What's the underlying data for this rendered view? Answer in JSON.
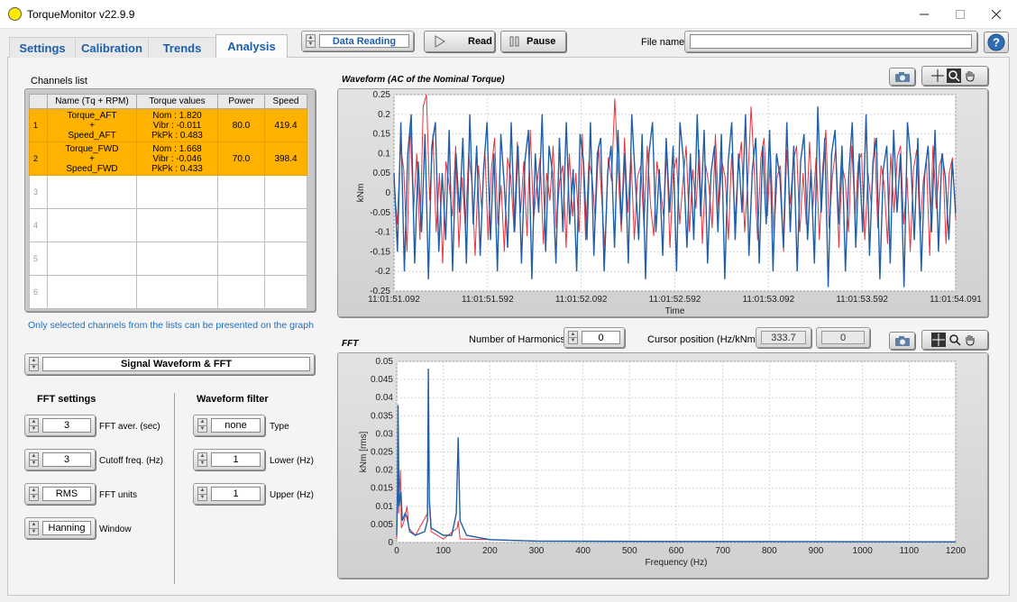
{
  "window": {
    "title": "TorqueMonitor v22.9.9"
  },
  "tabs": [
    {
      "label": "Settings"
    },
    {
      "label": "Calibration"
    },
    {
      "label": "Trends"
    },
    {
      "label": "Analysis"
    }
  ],
  "toolbar": {
    "mode_value": "Data Reading",
    "read_label": "Read",
    "pause_label": "Pause",
    "file_name_label": "File name",
    "file_name_value": ""
  },
  "channels": {
    "title": "Channels list",
    "headers": [
      "Name (Tq + RPM)",
      "Torque values",
      "Power",
      "Speed"
    ],
    "rows": [
      {
        "index": "1",
        "name": [
          "Torque_AFT",
          "+",
          "Speed_AFT"
        ],
        "torque": [
          "Nom : 1.820",
          "Vibr : -0.011",
          "PkPk : 0.483"
        ],
        "power": "80.0",
        "speed": "419.4"
      },
      {
        "index": "2",
        "name": [
          "Torque_FWD",
          "+",
          "Speed_FWD"
        ],
        "torque": [
          "Nom : 1.668",
          "Vibr : -0.046",
          "PkPk : 0.433"
        ],
        "power": "70.0",
        "speed": "398.4"
      },
      {
        "index": "3"
      },
      {
        "index": "4"
      },
      {
        "index": "5"
      },
      {
        "index": "6"
      }
    ],
    "note": "Only selected channels from the lists can be presented on the graph"
  },
  "view_mode": "Signal Waveform & FFT",
  "fft_settings": {
    "title": "FFT settings",
    "aver_value": "3",
    "aver_label": "FFT aver. (sec)",
    "cutoff_value": "3",
    "cutoff_label": "Cutoff freq. (Hz)",
    "units_value": "RMS",
    "units_label": "FFT units",
    "window_value": "Hanning",
    "window_label": "Window"
  },
  "waveform_filter": {
    "title": "Waveform filter",
    "type_value": "none",
    "type_label": "Type",
    "lower_value": "1",
    "lower_label": "Lower (Hz)",
    "upper_value": "1",
    "upper_label": "Upper (Hz)"
  },
  "harmonics": {
    "label": "Number of Harmonics",
    "value": "0"
  },
  "cursor": {
    "label": "Cursor position (Hz/kNm):",
    "x": "333.7",
    "y": "0"
  },
  "colors": {
    "series_blue": "#1f5fa6",
    "series_red": "#e8323c",
    "selected_row": "#ffb300",
    "tab_text": "#1a5fab"
  },
  "icons": [
    "camera-icon",
    "crosshair-icon",
    "zoom-icon",
    "hand-pan-icon",
    "help-icon",
    "play-icon",
    "pause-icon"
  ],
  "chart_data": [
    {
      "type": "line",
      "title": "Waveform (AC of the Nominal Torque)",
      "xlabel": "Time",
      "ylabel": "kNm",
      "x_tick_labels": [
        "11:01:51.092",
        "11:01:51.592",
        "11:01:52.092",
        "11:01:52.592",
        "11:01:53.092",
        "11:01:53.592",
        "11:01:54.091"
      ],
      "y_tick_labels": [
        "0.25",
        "0.2",
        "0.15",
        "0.1",
        "0.05",
        "0",
        "-0.05",
        "-0.1",
        "-0.15",
        "-0.2",
        "-0.25"
      ],
      "ylim": [
        -0.25,
        0.25
      ],
      "grid": true,
      "series": [
        {
          "color": "#e8323c",
          "y": [
            0.03,
            -0.08,
            0.12,
            0.06,
            -0.15,
            0.18,
            -0.05,
            0.1,
            -0.12,
            0.22,
            0.25,
            -0.02,
            0.15,
            -0.1,
            0.05,
            -0.18,
            0.08,
            0.02,
            -0.06,
            0.12,
            -0.14,
            0.04,
            -0.09,
            0.1,
            0.03,
            -0.16,
            0.07,
            -0.04,
            0.11,
            -0.12,
            0.06,
            0.14,
            -0.08,
            0.02,
            -0.15,
            0.09,
            0.04,
            -0.1,
            0.13,
            -0.05,
            0.08,
            -0.11,
            0.16,
            -0.07,
            0.02,
            0.09,
            -0.13,
            0.05,
            -0.02,
            0.12,
            -0.09,
            0.03,
            0.07,
            -0.14,
            0.1,
            -0.06,
            0.05,
            -0.1,
            0.15,
            -0.12,
            0.08,
            0.04,
            -0.07,
            0.12,
            -0.02,
            -0.15,
            0.09,
            0.03,
            0.24,
            0.06,
            -0.1,
            0.14,
            -0.05,
            0.1,
            -0.12,
            0.04,
            0.07,
            -0.09,
            0.12,
            -0.03,
            -0.11,
            0.08,
            0.02,
            -0.06,
            0.1,
            -0.14,
            0.05,
            0.09,
            -0.08,
            0.03,
            0.12,
            -0.1,
            0.06,
            -0.04,
            0.11,
            -0.13,
            0.07,
            0.02,
            -0.09,
            0.15,
            -0.05,
            0.08,
            0.04,
            -0.12,
            0.1,
            -0.07,
            0.06,
            0.13,
            -0.1,
            0.03,
            0.22,
            0.05,
            -0.12,
            0.09,
            0.14,
            -0.06,
            0.1,
            -0.11,
            0.04,
            0.07,
            -0.15,
            0.11,
            -0.03,
            0.08,
            0.12,
            -0.1,
            0.05,
            -0.08,
            0.13,
            -0.04,
            0.09,
            -0.12,
            0.06,
            0.16,
            -0.09,
            0.04,
            0.11,
            -0.14,
            0.07,
            0.03,
            -0.1,
            0.12,
            -0.06,
            0.08,
            0.1,
            -0.12,
            0.05,
            -0.03,
            0.14,
            -0.09,
            0.07,
            0.02,
            -0.13,
            0.1,
            -0.05,
            0.09,
            0.12,
            -0.08,
            0.04,
            -0.15,
            0.06,
            0.11,
            -0.1,
            0.03,
            0.08,
            -0.16,
            0.12,
            -0.04,
            0.07,
            0.1,
            -0.13,
            0.05,
            0.09,
            -0.07
          ]
        },
        {
          "color": "#1f5fa6",
          "y": [
            0.05,
            -0.15,
            0.18,
            -0.2,
            0.1,
            0.2,
            -0.18,
            0.08,
            -0.1,
            0.15,
            -0.22,
            0.12,
            0.18,
            -0.15,
            0.05,
            -0.12,
            0.16,
            -0.2,
            0.1,
            -0.05,
            0.14,
            -0.18,
            0.2,
            -0.08,
            0.12,
            -0.16,
            0.06,
            0.18,
            -0.12,
            0.1,
            -0.2,
            0.15,
            0.02,
            -0.14,
            0.18,
            -0.1,
            0.12,
            -0.18,
            0.08,
            0.16,
            -0.22,
            0.1,
            -0.05,
            0.2,
            -0.15,
            0.12,
            0.05,
            -0.18,
            0.14,
            -0.1,
            0.18,
            -0.08,
            0.06,
            -0.2,
            0.15,
            0.08,
            -0.12,
            0.18,
            -0.16,
            0.1,
            0.14,
            -0.2,
            0.05,
            0.12,
            -0.14,
            0.16,
            -0.08,
            0.1,
            -0.18,
            0.2,
            0.04,
            -0.12,
            0.15,
            -0.22,
            0.1,
            0.18,
            -0.1,
            0.06,
            -0.16,
            0.14,
            -0.05,
            0.12,
            -0.2,
            0.18,
            0.08,
            -0.14,
            0.1,
            -0.12,
            0.2,
            -0.06,
            0.16,
            -0.18,
            0.05,
            0.12,
            -0.1,
            0.15,
            -0.22,
            0.08,
            0.18,
            -0.12,
            0.1,
            -0.05,
            0.2,
            -0.16,
            0.06,
            0.14,
            -0.18,
            0.12,
            -0.08,
            0.16,
            -0.2,
            0.1,
            0.04,
            -0.14,
            0.18,
            -0.1,
            0.12,
            -0.2,
            0.08,
            0.15,
            -0.12,
            0.06,
            -0.18,
            0.22,
            -0.05,
            0.14,
            -0.24,
            0.1,
            0.16,
            -0.08,
            0.12,
            -0.2,
            0.05,
            0.18,
            -0.14,
            0.1,
            -0.1,
            0.2,
            -0.16,
            0.08,
            0.14,
            -0.22,
            0.06,
            0.12,
            -0.18,
            0.16,
            -0.05,
            0.1,
            -0.24,
            0.18,
            0.08,
            -0.12,
            0.14,
            -0.2,
            0.05,
            0.12,
            -0.1,
            0.16,
            -0.15,
            0.1,
            0.04,
            -0.12,
            0.08,
            -0.05
          ]
        }
      ]
    },
    {
      "type": "line",
      "title": "FFT",
      "xlabel": "Frequency (Hz)",
      "ylabel": "kNm [rms]",
      "x_tick_labels": [
        "0",
        "100",
        "200",
        "300",
        "400",
        "500",
        "600",
        "700",
        "800",
        "900",
        "1000",
        "1100",
        "1200"
      ],
      "y_tick_labels": [
        "0.05",
        "0.045",
        "0.04",
        "0.035",
        "0.03",
        "0.025",
        "0.02",
        "0.015",
        "0.01",
        "0.005",
        "0"
      ],
      "xlim": [
        0,
        1200
      ],
      "ylim": [
        0,
        0.05
      ],
      "grid": true,
      "series": [
        {
          "color": "#e8323c",
          "points": [
            [
              0,
              0.001
            ],
            [
              2,
              0.018
            ],
            [
              4,
              0.008
            ],
            [
              8,
              0.02
            ],
            [
              10,
              0.004
            ],
            [
              16,
              0.006
            ],
            [
              22,
              0.01
            ],
            [
              26,
              0.004
            ],
            [
              40,
              0.002
            ],
            [
              66,
              0.008
            ],
            [
              68,
              0.03
            ],
            [
              70,
              0.01
            ],
            [
              74,
              0.003
            ],
            [
              100,
              0.001
            ],
            [
              130,
              0.004
            ],
            [
              132,
              0.006
            ],
            [
              136,
              0.001
            ],
            [
              200,
              0.0008
            ],
            [
              300,
              0.0004
            ],
            [
              600,
              0.0003
            ],
            [
              1200,
              0.0002
            ]
          ]
        },
        {
          "color": "#1f5fa6",
          "points": [
            [
              0,
              0.002
            ],
            [
              2,
              0.015
            ],
            [
              3,
              0.038
            ],
            [
              5,
              0.01
            ],
            [
              9,
              0.014
            ],
            [
              12,
              0.006
            ],
            [
              18,
              0.008
            ],
            [
              22,
              0.007
            ],
            [
              28,
              0.003
            ],
            [
              40,
              0.002
            ],
            [
              60,
              0.003
            ],
            [
              66,
              0.006
            ],
            [
              68,
              0.048
            ],
            [
              70,
              0.012
            ],
            [
              74,
              0.004
            ],
            [
              100,
              0.002
            ],
            [
              118,
              0.002
            ],
            [
              128,
              0.008
            ],
            [
              132,
              0.029
            ],
            [
              136,
              0.006
            ],
            [
              150,
              0.002
            ],
            [
              200,
              0.0008
            ],
            [
              300,
              0.0004
            ],
            [
              600,
              0.0003
            ],
            [
              1200,
              0.0002
            ]
          ]
        }
      ]
    }
  ]
}
